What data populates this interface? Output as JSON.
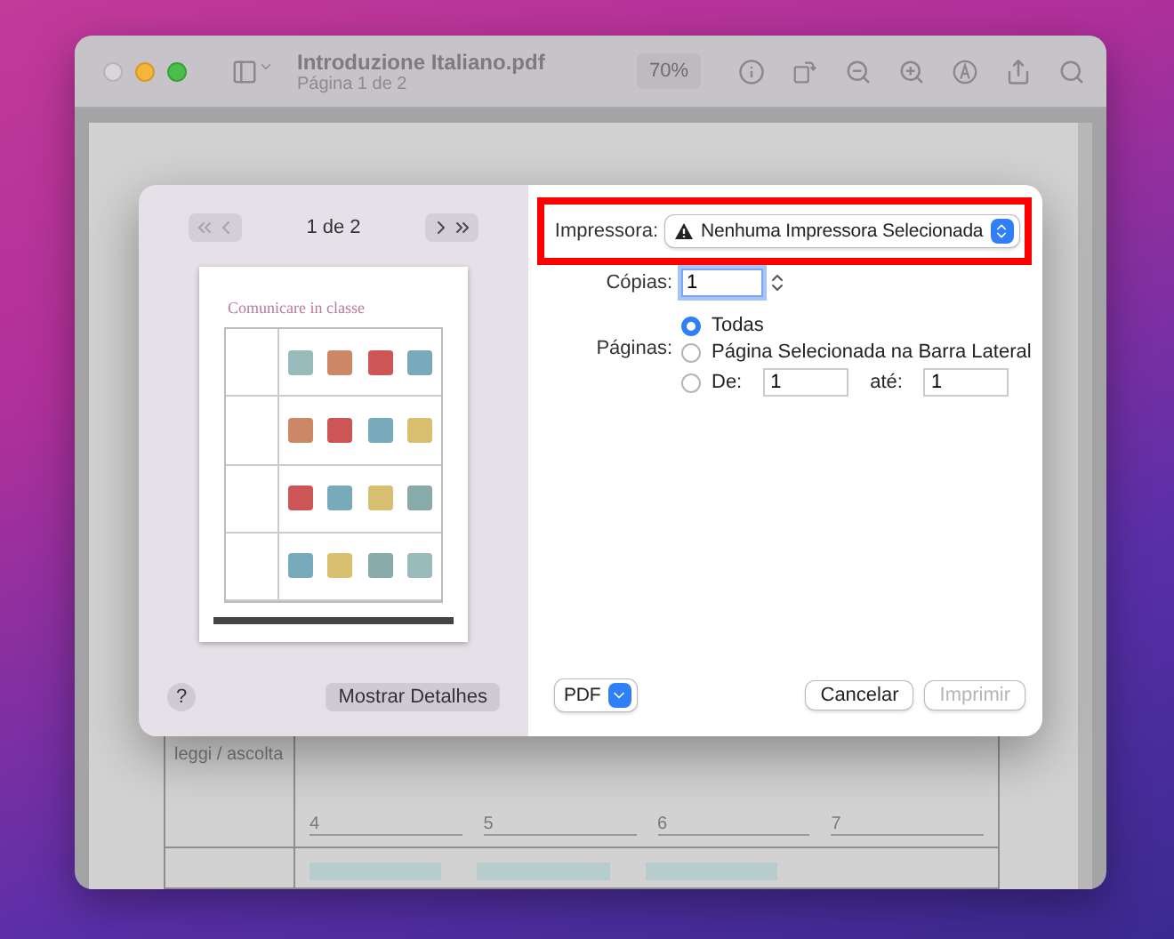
{
  "window": {
    "title": "Introduzione Italiano.pdf",
    "subtitle": "Página 1 de 2",
    "zoom": "70%"
  },
  "document": {
    "rows": [
      {
        "label": "leggi / ascolta",
        "blanks": [
          "4",
          "5",
          "6",
          "7"
        ]
      }
    ]
  },
  "print_dialog": {
    "preview": {
      "page_indicator": "1 de 2",
      "page_title": "Comunicare in classe"
    },
    "help": "?",
    "details_button": "Mostrar Detalhes",
    "printer": {
      "label": "Impressora:",
      "value": "Nenhuma Impressora Selecionada",
      "highlighted": true
    },
    "copies": {
      "label": "Cópias:",
      "value": "1"
    },
    "pages": {
      "label": "Páginas:",
      "options": [
        {
          "kind": "radio",
          "label": "Todas",
          "selected": true
        },
        {
          "kind": "radio",
          "label": "Página Selecionada na Barra Lateral",
          "selected": false
        },
        {
          "kind": "range",
          "label": "De:",
          "selected": false,
          "from": "1",
          "to_label": "até:",
          "to": "1"
        }
      ]
    },
    "pdf_button": "PDF",
    "cancel_button": "Cancelar",
    "print_button": {
      "label": "Imprimir",
      "disabled": true
    }
  }
}
